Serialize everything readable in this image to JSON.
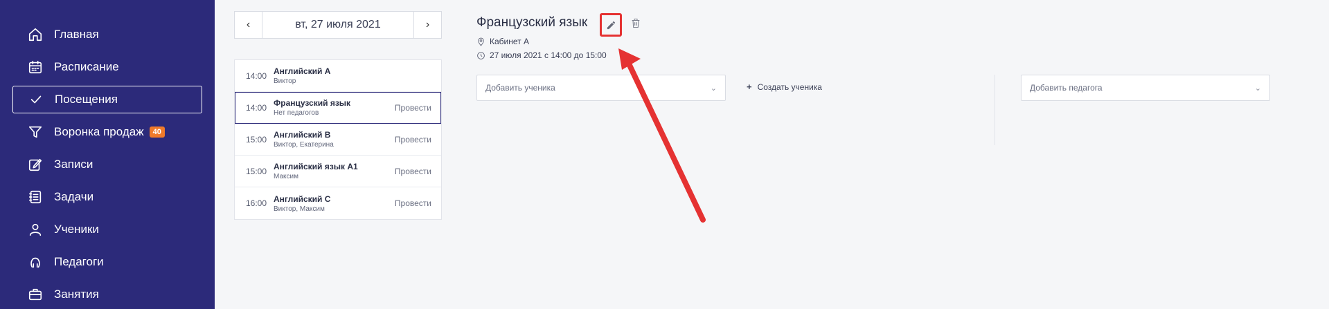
{
  "sidebar": {
    "items": [
      {
        "label": "Главная",
        "icon": "home-icon"
      },
      {
        "label": "Расписание",
        "icon": "calendar-icon"
      },
      {
        "label": "Посещения",
        "icon": "check-icon",
        "active": true
      },
      {
        "label": "Воронка продаж",
        "icon": "funnel-icon",
        "badge": "40"
      },
      {
        "label": "Записи",
        "icon": "edit-note-icon"
      },
      {
        "label": "Задачи",
        "icon": "tasks-icon"
      },
      {
        "label": "Ученики",
        "icon": "user-icon"
      },
      {
        "label": "Педагоги",
        "icon": "teacher-icon"
      },
      {
        "label": "Занятия",
        "icon": "briefcase-icon"
      }
    ]
  },
  "date_switcher": {
    "prev_icon": "chevron-left-icon",
    "date": "вт, 27 июля 2021",
    "next_icon": "chevron-right-icon"
  },
  "lessons": [
    {
      "time": "14:00",
      "title": "Английский А",
      "sub": "Виктор",
      "action": ""
    },
    {
      "time": "14:00",
      "title": "Французский язык",
      "sub": "Нет педагогов",
      "action": "Провести",
      "selected": true
    },
    {
      "time": "15:00",
      "title": "Английский В",
      "sub": "Виктор, Екатерина",
      "action": "Провести"
    },
    {
      "time": "15:00",
      "title": "Английский язык А1",
      "sub": "Максим",
      "action": "Провести"
    },
    {
      "time": "16:00",
      "title": "Английский С",
      "sub": "Виктор, Максим",
      "action": "Провести"
    }
  ],
  "detail": {
    "title": "Французский язык",
    "room": "Кабинет А",
    "time_range": "27 июля 2021 с 14:00 до 15:00",
    "add_student_placeholder": "Добавить ученика",
    "create_student_label": "Создать ученика",
    "add_teacher_placeholder": "Добавить педагога"
  },
  "colors": {
    "sidebar_bg": "#2c2a7a",
    "badge": "#f07a2a",
    "annotation_red": "#e53232"
  }
}
